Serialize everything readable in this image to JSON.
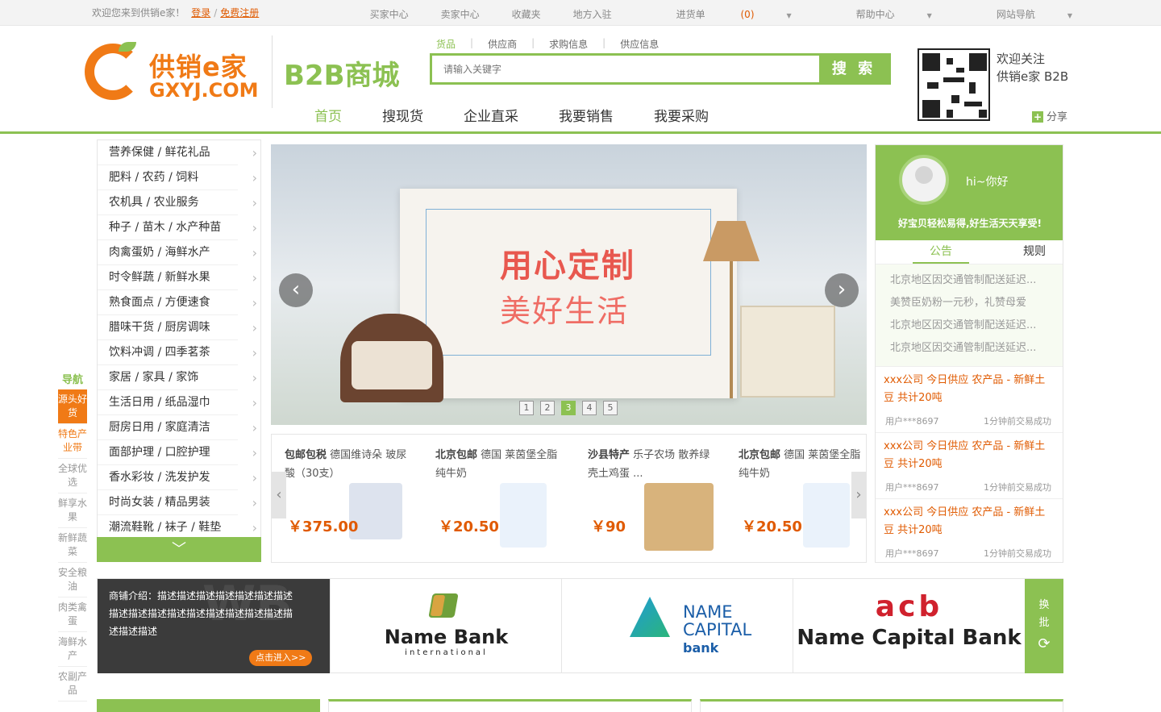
{
  "topbar": {
    "welcome": "欢迎您来到供销e家！",
    "login": "登录",
    "register": "免费注册",
    "sep": "/",
    "links": [
      "买家中心",
      "卖家中心",
      "收藏夹",
      "地方入驻"
    ],
    "cart_label": "进货单",
    "cart_count": "(0)",
    "help": "帮助中心",
    "sitenav": "网站导航"
  },
  "header": {
    "logo_cn": "供销e家",
    "logo_en": "GXYJ.COM",
    "b2b": "B2B商城",
    "search_tabs": [
      "货品",
      "供应商",
      "求购信息",
      "供应信息"
    ],
    "search_placeholder": "请输入关键字",
    "search_button": "搜 索",
    "qr_line1": "欢迎关注",
    "qr_line2": "供销e家 B2B",
    "share": "分享",
    "nav": [
      "首页",
      "搜现货",
      "企业直采",
      "我要销售",
      "我要采购"
    ]
  },
  "sidenav": {
    "title": "导航",
    "items": [
      "源头好货",
      "特色产业带",
      "全球优选",
      "鲜享水果",
      "新鲜蔬菜",
      "安全粮油",
      "肉类禽蛋",
      "海鲜水产",
      "农副产品"
    ]
  },
  "categories": [
    "营养保健 / 鲜花礼品",
    "肥料 / 农药 / 饲料",
    "农机具 / 农业服务",
    "种子 / 苗木 / 水产种苗",
    "肉禽蛋奶 / 海鲜水产",
    "时令鲜蔬 / 新鲜水果",
    "熟食面点 / 方便速食",
    "腊味干货 / 厨房调味",
    "饮料冲调 / 四季茗茶",
    "家居 / 家具 / 家饰",
    "生活日用 / 纸品湿巾",
    "厨房日用 / 家庭清洁",
    "面部护理 / 口腔护理",
    "香水彩妆 / 洗发护发",
    "时尚女装 / 精品男装",
    "潮流鞋靴 / 袜子 / 鞋垫"
  ],
  "categories_more": "﹀",
  "banner": {
    "slogan1": "用心定制",
    "slogan2": "美好生活",
    "prev": "‹",
    "next": "›",
    "dots": [
      "1",
      "2",
      "3",
      "4",
      "5"
    ],
    "active_dot": 3
  },
  "products": [
    {
      "tag": "包邮包税",
      "name": "德国维诗朵 玻尿酸（30支）",
      "price": "￥375.00"
    },
    {
      "tag": "北京包邮",
      "name": "德国 莱茵堡全脂纯牛奶",
      "price": "￥20.50"
    },
    {
      "tag": "沙县特产",
      "name": "乐子农场 散养绿壳土鸡蛋 ...",
      "price": "￥90"
    },
    {
      "tag": "北京包邮",
      "name": "德国 莱茵堡全脂纯牛奶",
      "price": "￥20.50"
    }
  ],
  "products_prev": "‹",
  "products_next": "›",
  "user_panel": {
    "greeting": "hi~你好",
    "slogan": "好宝贝轻松易得,好生活天天享受!",
    "tabs": [
      "公告",
      "规则"
    ],
    "notices": [
      "北京地区因交通管制配送延迟...",
      "美赞臣奶粉一元秒，礼赞母爱",
      "北京地区因交通管制配送延迟...",
      "北京地区因交通管制配送延迟..."
    ],
    "deals": [
      {
        "text": "xxx公司 今日供应 农产品 - 新鲜土豆 共计20吨",
        "user": "用户***8697",
        "status": "1分钟前交易成功"
      },
      {
        "text": "xxx公司 今日供应 农产品 - 新鲜土豆 共计20吨",
        "user": "用户***8697",
        "status": "1分钟前交易成功"
      },
      {
        "text": "xxx公司 今日供应 农产品 - 新鲜土豆 共计20吨",
        "user": "用户***8697",
        "status": "1分钟前交易成功"
      }
    ]
  },
  "shops": {
    "intro": "商铺介绍：描述描述描述描述描述描述描述描述描述描述描述描述描述描述描述描述描述描述描述",
    "enter": "点击进入>>",
    "brand1_name": "Name Bank",
    "brand1_sub": "international",
    "brand2_line1": "NAME",
    "brand2_line2": "CAPITAL",
    "brand2_line3": "bank",
    "brand3_mark": "acb",
    "brand3_name": "Name Capital Bank",
    "swap": "换批"
  }
}
